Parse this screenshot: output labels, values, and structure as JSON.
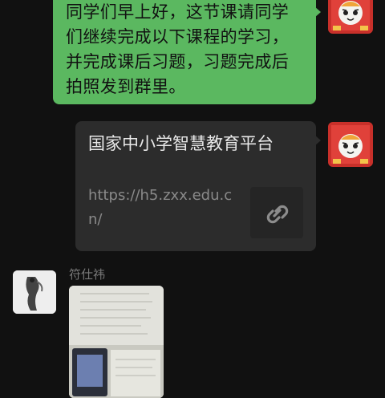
{
  "messages": {
    "text_message": "同学们早上好，这节课请同学们继续完成以下课程的学习，并完成课后习题，习题完成后拍照发到群里。",
    "link_card": {
      "title": "国家中小学智慧教育平台",
      "url": "https://h5.zxx.edu.cn/"
    },
    "incoming": {
      "sender": "符仕祎"
    }
  },
  "icons": {
    "link": "link-icon",
    "teacher_avatar": "tiger-avatar-icon",
    "student_avatar": "sketch-avatar-icon"
  },
  "colors": {
    "background": "#111111",
    "sent_bubble": "#5bb860",
    "card": "#2c2c2c"
  }
}
